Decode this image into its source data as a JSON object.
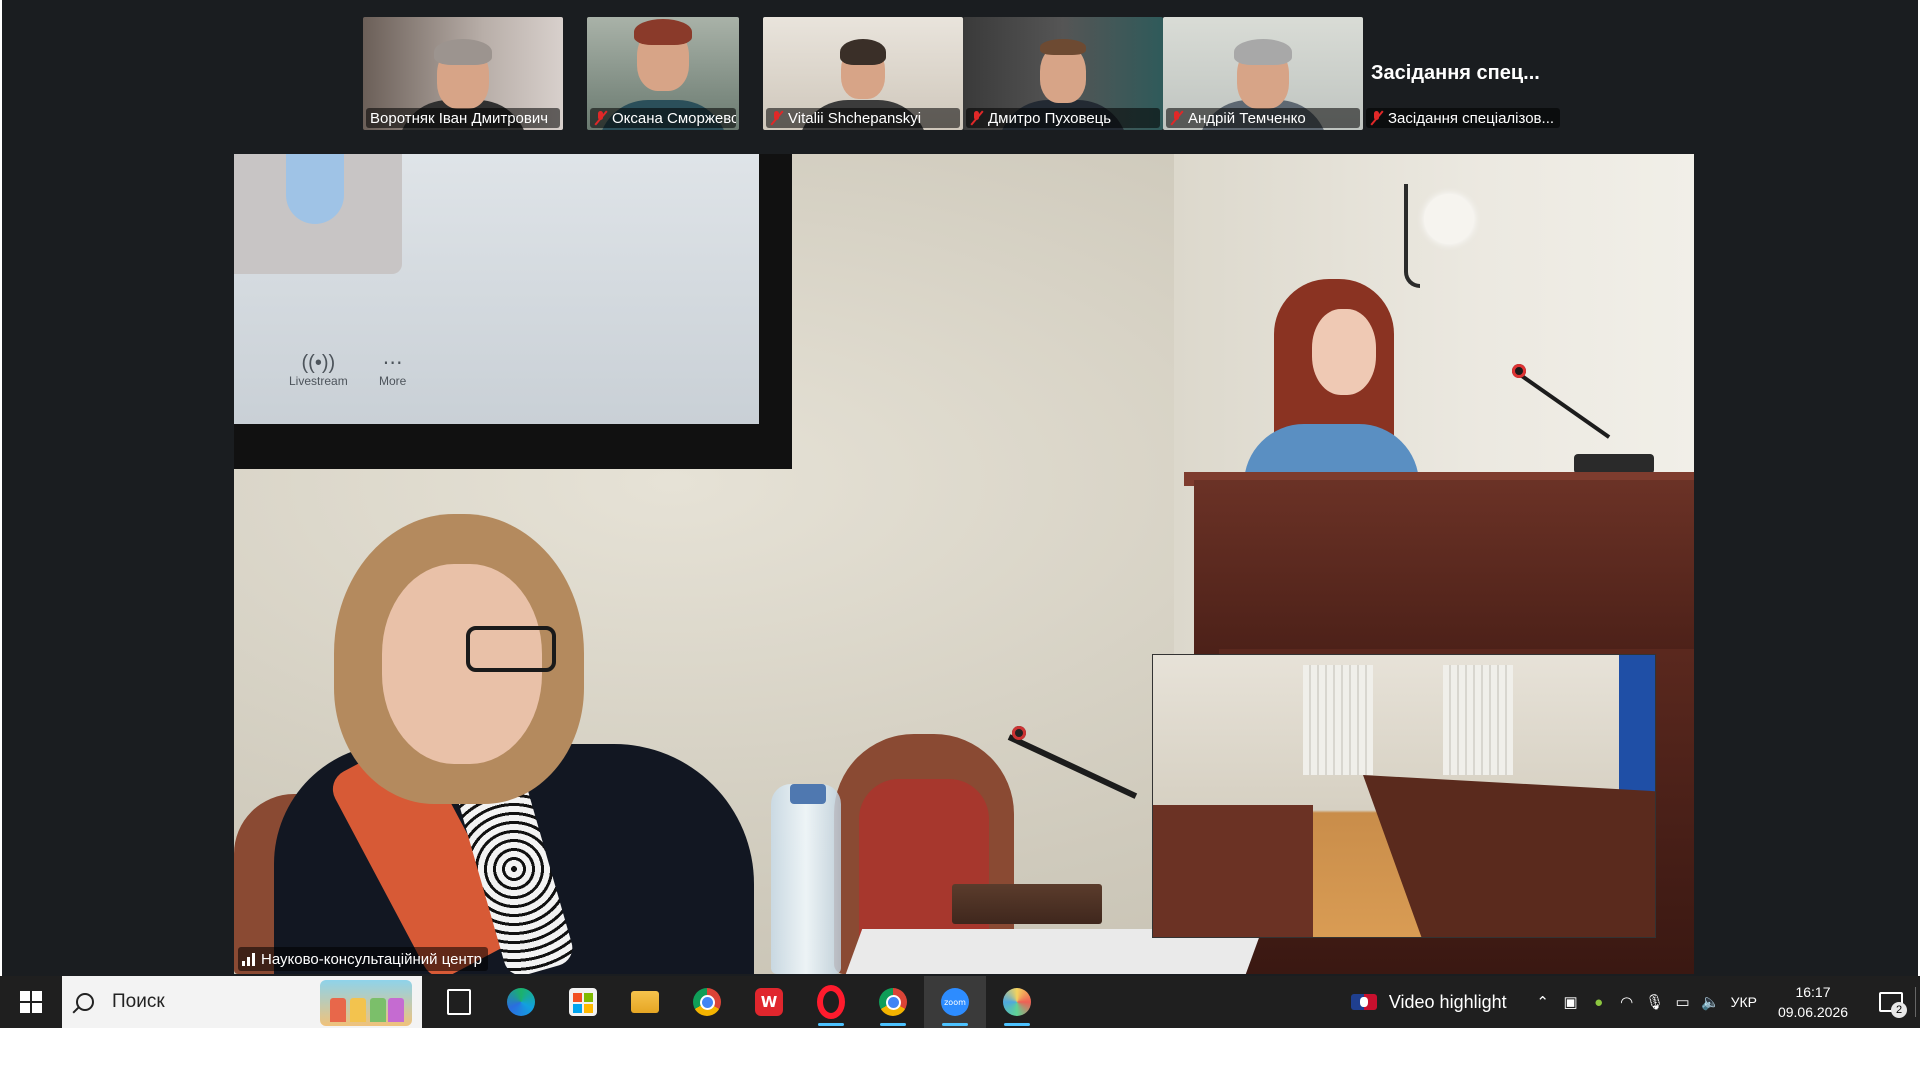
{
  "meeting": {
    "participants": [
      {
        "name": "Воротняк Іван Дмитрович",
        "muted": false
      },
      {
        "name": "Оксана Сморжевська",
        "muted": true
      },
      {
        "name": "Vitalii Shchepanskyi",
        "muted": true
      },
      {
        "name": "Дмитро Пуховець",
        "muted": true
      },
      {
        "name": "Андрій Темченко",
        "muted": true
      }
    ],
    "title_tile": {
      "title": "Засідання спец...",
      "name": "Засідання спеціалізов..."
    },
    "main_speaker_name": "Науково-консультаційний центр",
    "shared_screen_controls": {
      "livestream": "Livestream",
      "more": "More"
    }
  },
  "taskbar": {
    "search_placeholder": "Поиск",
    "apps": [
      {
        "icon": "task-view-icon"
      },
      {
        "icon": "edge-icon"
      },
      {
        "icon": "store-icon"
      },
      {
        "icon": "file-explorer-icon"
      },
      {
        "icon": "chrome-icon"
      },
      {
        "icon": "wps-office-icon",
        "label": "W"
      },
      {
        "icon": "opera-icon"
      },
      {
        "icon": "chrome-profile-icon"
      },
      {
        "icon": "zoom-icon",
        "label": "zoom"
      },
      {
        "icon": "paint-icon"
      }
    ],
    "widget": "Video highlight",
    "language": "УКР",
    "time": "16:17",
    "date": "09.06.2026",
    "notifications_count": "2"
  },
  "colors": {
    "zoom_bg": "#1a1d20",
    "muted_red": "#e02828",
    "taskbar_bg": "#1f1f1f",
    "running_indicator": "#4cc2ff"
  }
}
